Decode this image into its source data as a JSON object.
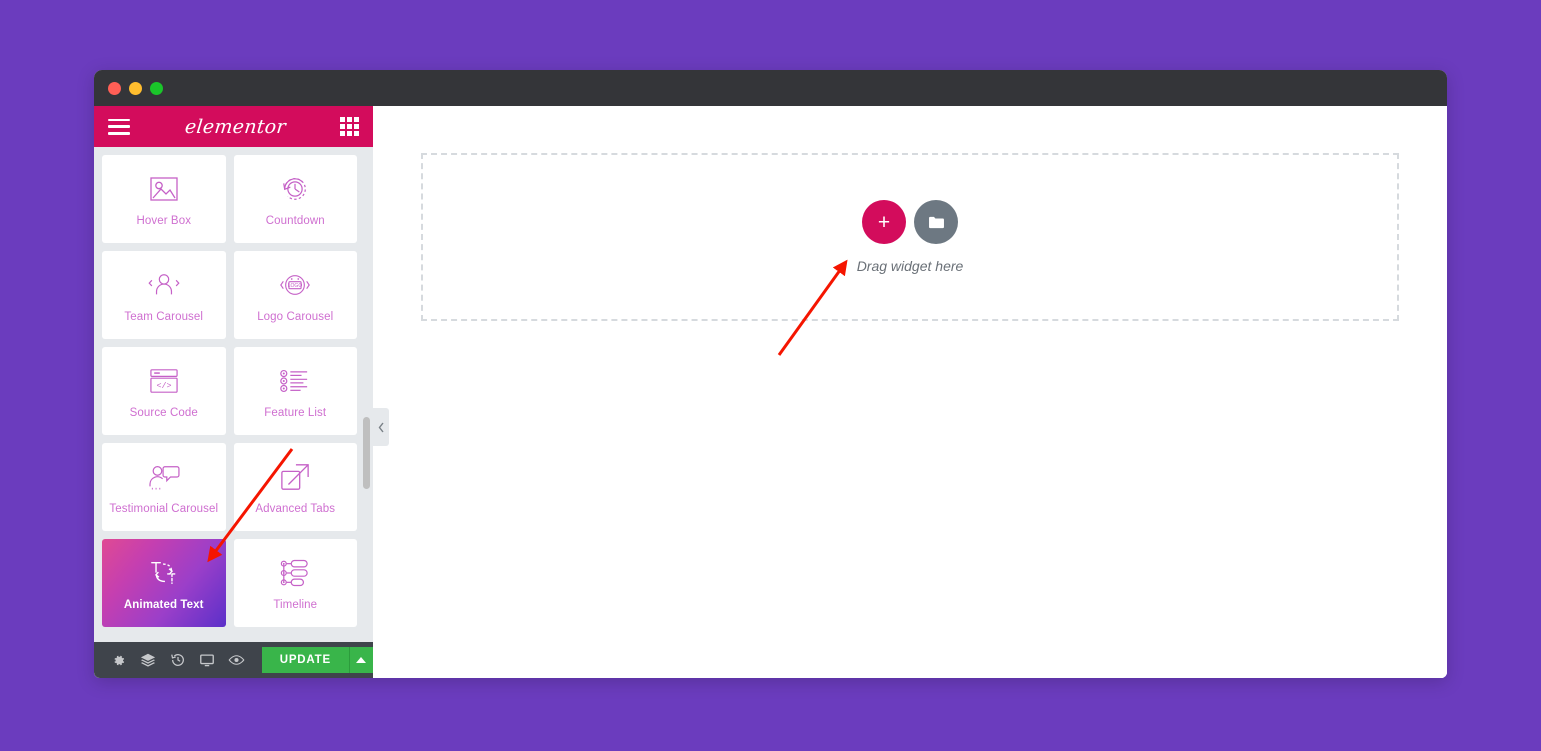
{
  "window": {
    "titlebar_dots": [
      "close",
      "minimize",
      "maximize"
    ]
  },
  "panel": {
    "brand": "elementor",
    "menu_icon": "hamburger-menu-icon",
    "grid_icon": "widgets-grid-icon",
    "widgets": [
      {
        "label": "Hover Box",
        "icon": "image-placeholder-icon",
        "active": false
      },
      {
        "label": "Countdown",
        "icon": "clock-rewind-icon",
        "active": false
      },
      {
        "label": "Team Carousel",
        "icon": "person-carousel-icon",
        "active": false
      },
      {
        "label": "Logo Carousel",
        "icon": "logo-carousel-icon",
        "active": false
      },
      {
        "label": "Source Code",
        "icon": "code-window-icon",
        "active": false
      },
      {
        "label": "Feature List",
        "icon": "feature-list-icon",
        "active": false
      },
      {
        "label": "Testimonial Carousel",
        "icon": "testimonial-quote-icon",
        "active": false
      },
      {
        "label": "Advanced Tabs",
        "icon": "expand-box-icon",
        "active": false
      },
      {
        "label": "Animated Text",
        "icon": "animated-text-icon",
        "active": true
      },
      {
        "label": "Timeline",
        "icon": "timeline-icon",
        "active": false
      }
    ],
    "footer": {
      "settings_icon": "gear-icon",
      "navigator_icon": "layers-icon",
      "history_icon": "history-clock-icon",
      "responsive_icon": "monitor-icon",
      "preview_icon": "eye-icon",
      "update_label": "UPDATE",
      "update_caret_icon": "caret-up-icon"
    },
    "collapse_icon": "chevron-left-icon"
  },
  "canvas": {
    "add_section_icon": "plus-icon",
    "template_library_icon": "folder-icon",
    "drag_hint": "Drag widget here"
  },
  "colors": {
    "desktop_background": "#6b3cbe",
    "titlebar": "#343539",
    "elementor_pink": "#d30c5c",
    "panel_background": "#e6e9ec",
    "footer_background": "#3f444b",
    "update_green": "#39b54a",
    "widget_label": "#cf6fd0",
    "annotation_red": "#f51500",
    "active_gradient_from": "#e04a93",
    "active_gradient_to": "#5b30c9"
  }
}
